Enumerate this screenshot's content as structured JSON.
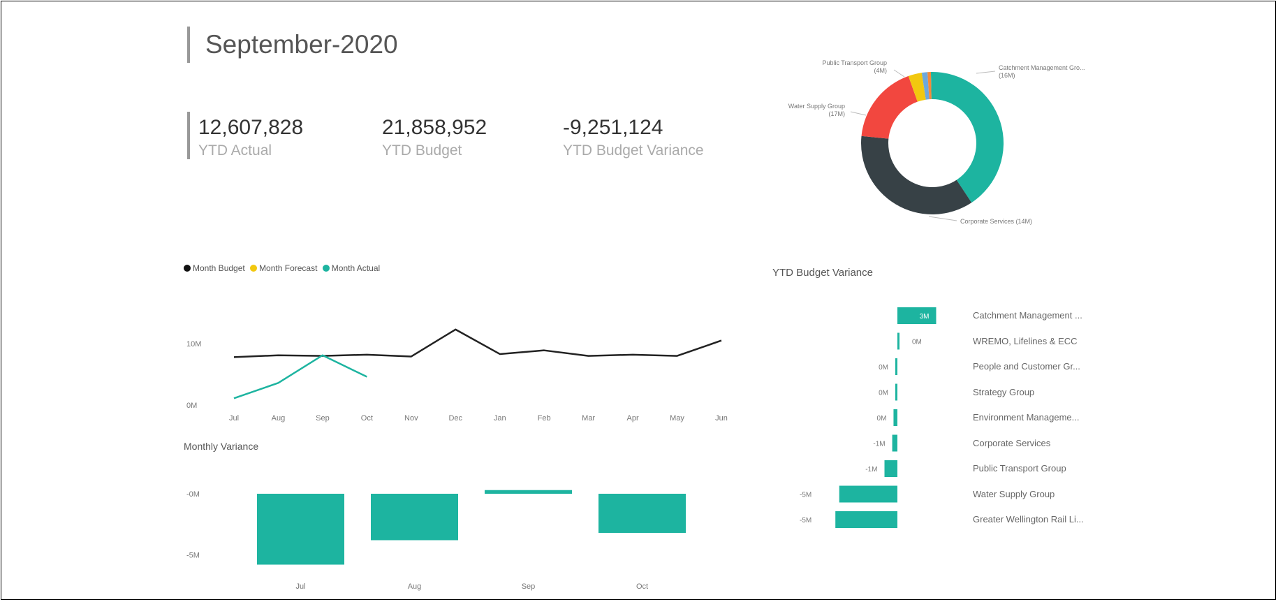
{
  "title": "September-2020",
  "kpis": [
    {
      "value": "12,607,828",
      "label": "YTD Actual"
    },
    {
      "value": "21,858,952",
      "label": "YTD Budget"
    },
    {
      "value": "-9,251,124",
      "label": "YTD Budget Variance"
    }
  ],
  "colors": {
    "teal": "#1db4a0",
    "black": "#222222",
    "yellow": "#f2c80f",
    "red": "#f2473f",
    "dark": "#374146",
    "blue": "#6fa8dc",
    "orange": "#f58a3b"
  },
  "line_chart": {
    "legend": [
      {
        "name": "Month Budget",
        "color": "#111111"
      },
      {
        "name": "Month Forecast",
        "color": "#f2c80f"
      },
      {
        "name": "Month Actual",
        "color": "#1db4a0"
      }
    ],
    "y_ticks": [
      "10M",
      "0M"
    ]
  },
  "variance_chart": {
    "title": "Monthly Variance",
    "y_ticks": [
      "-0M",
      "-5M"
    ]
  },
  "donut": {
    "labels": [
      {
        "text1": "Public Transport Group",
        "text2": "(4M)"
      },
      {
        "text1": "Water Supply Group",
        "text2": "(17M)"
      },
      {
        "text1": "Catchment Management Gro...",
        "text2": "(16M)"
      },
      {
        "text1": "Corporate Services (14M)",
        "text2": ""
      }
    ]
  },
  "ytd_variance": {
    "title": "YTD Budget Variance"
  },
  "chart_data": [
    {
      "type": "line",
      "x": [
        "Jul",
        "Aug",
        "Sep",
        "Oct",
        "Nov",
        "Dec",
        "Jan",
        "Feb",
        "Mar",
        "Apr",
        "May",
        "Jun"
      ],
      "ylim": [
        0,
        10
      ],
      "series": [
        {
          "name": "Month Budget",
          "values": [
            7.8,
            8.1,
            8.0,
            8.2,
            7.9,
            12.3,
            8.3,
            8.9,
            8.0,
            8.2,
            8.0,
            10.5
          ]
        },
        {
          "name": "Month Actual",
          "values": [
            1.1,
            3.6,
            8.1,
            4.6,
            null,
            null,
            null,
            null,
            null,
            null,
            null,
            null
          ]
        }
      ]
    },
    {
      "type": "bar",
      "title": "Monthly Variance",
      "categories": [
        "Jul",
        "Aug",
        "Sep",
        "Oct"
      ],
      "values": [
        -5.8,
        -3.8,
        0.3,
        -3.2
      ],
      "ylim": [
        -6,
        0
      ]
    },
    {
      "type": "pie",
      "slices": [
        {
          "name": "Catchment Management Gro...",
          "value": 16,
          "color": "#1db4a0"
        },
        {
          "name": "Corporate Services",
          "value": 14,
          "color": "#374146"
        },
        {
          "name": "Water Supply Group",
          "value": 7,
          "color": "#f2473f"
        },
        {
          "name": "Public Transport Group",
          "value": 1.2,
          "color": "#f2c80f"
        },
        {
          "name": "",
          "value": 0.5,
          "color": "#6fa8dc"
        },
        {
          "name": "",
          "value": 0.3,
          "color": "#f58a3b"
        }
      ]
    },
    {
      "type": "bar",
      "title": "YTD Budget Variance",
      "categories": [
        "Catchment Management ...",
        "WREMO, Lifelines & ECC",
        "People and Customer Gr...",
        "Strategy Group",
        "Environment Manageme...",
        "Corporate Services",
        "Public Transport Group",
        "Water Supply Group",
        "Greater Wellington Rail Li..."
      ],
      "values": [
        3.0,
        0.1,
        -0.1,
        -0.1,
        -0.3,
        -0.4,
        -1.0,
        -4.5,
        -4.8
      ],
      "value_labels": [
        "3M",
        "0M",
        "0M",
        "0M",
        "0M",
        "-1M",
        "-1M",
        "-5M",
        "-5M"
      ]
    }
  ]
}
